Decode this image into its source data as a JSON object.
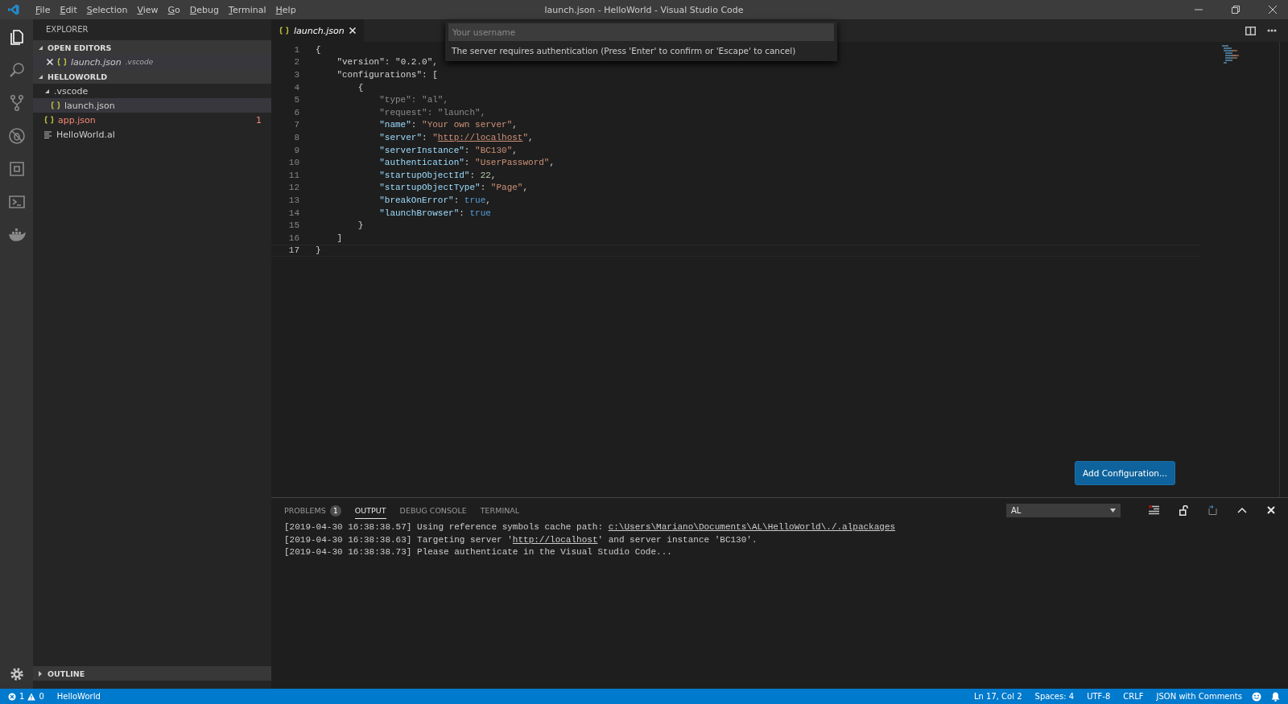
{
  "window": {
    "title": "launch.json - HelloWorld - Visual Studio Code"
  },
  "menu": [
    "File",
    "Edit",
    "Selection",
    "View",
    "Go",
    "Debug",
    "Terminal",
    "Help"
  ],
  "activity_bar": [
    {
      "kind": "files",
      "selected": true
    },
    {
      "kind": "search",
      "selected": false
    },
    {
      "kind": "scm",
      "selected": false
    },
    {
      "kind": "debug",
      "selected": false
    },
    {
      "kind": "extensions",
      "selected": false
    },
    {
      "kind": "terminal",
      "selected": false
    },
    {
      "kind": "docker",
      "selected": false
    }
  ],
  "sidebar": {
    "title": "EXPLORER",
    "open_editors": {
      "title": "OPEN EDITORS",
      "expanded": true,
      "items": [
        {
          "name": "launch.json",
          "folder": ".vscode",
          "kind": "json"
        }
      ]
    },
    "workspace": {
      "title": "HELLOWORLD",
      "expanded": true,
      "items": [
        {
          "name": ".vscode",
          "kind": "folder",
          "expanded": true,
          "selected": false,
          "children": [
            {
              "name": "launch.json",
              "kind": "json",
              "selected": true
            }
          ]
        },
        {
          "name": "app.json",
          "kind": "json",
          "selected": false,
          "errors": "1"
        },
        {
          "name": "HelloWorld.al",
          "kind": "file",
          "selected": false
        }
      ]
    },
    "outline": {
      "title": "OUTLINE",
      "expanded": false
    }
  },
  "editor": {
    "tabs": [
      {
        "label": "launch.json",
        "selected": true
      }
    ],
    "lines": [
      {
        "number": "1",
        "current": false,
        "tokens": [
          {
            "kind": "punct",
            "text": "{"
          }
        ]
      },
      {
        "number": "2",
        "current": false,
        "tokens": [
          {
            "kind": "plain",
            "text": "    \"version\""
          },
          {
            "kind": "punct",
            "text": ": "
          },
          {
            "kind": "plain",
            "text": "\"0.2.0\""
          },
          {
            "kind": "punct",
            "text": ","
          }
        ]
      },
      {
        "number": "3",
        "current": false,
        "tokens": [
          {
            "kind": "plain",
            "text": "    \"configurations\""
          },
          {
            "kind": "punct",
            "text": ": ["
          }
        ]
      },
      {
        "number": "4",
        "current": false,
        "tokens": [
          {
            "kind": "punct",
            "text": "        {"
          }
        ]
      },
      {
        "number": "5",
        "current": false,
        "tokens": [
          {
            "kind": "dim",
            "text": "            \"type\""
          },
          {
            "kind": "dim",
            "text": ": "
          },
          {
            "kind": "dim",
            "text": "\"al\""
          },
          {
            "kind": "dim",
            "text": ","
          }
        ]
      },
      {
        "number": "6",
        "current": false,
        "tokens": [
          {
            "kind": "dim",
            "text": "            \"request\""
          },
          {
            "kind": "dim",
            "text": ": "
          },
          {
            "kind": "dim",
            "text": "\"launch\""
          },
          {
            "kind": "dim",
            "text": ","
          }
        ]
      },
      {
        "number": "7",
        "current": false,
        "tokens": [
          {
            "kind": "key",
            "text": "            \"name\""
          },
          {
            "kind": "punct",
            "text": ": "
          },
          {
            "kind": "string",
            "text": "\"Your own server\""
          },
          {
            "kind": "punct",
            "text": ","
          }
        ]
      },
      {
        "number": "8",
        "current": false,
        "tokens": [
          {
            "kind": "key",
            "text": "            \"server\""
          },
          {
            "kind": "punct",
            "text": ": "
          },
          {
            "kind": "string",
            "text": "\""
          },
          {
            "kind": "link",
            "text": "http://localhost"
          },
          {
            "kind": "string",
            "text": "\""
          },
          {
            "kind": "punct",
            "text": ","
          }
        ]
      },
      {
        "number": "9",
        "current": false,
        "tokens": [
          {
            "kind": "key",
            "text": "            \"serverInstance\""
          },
          {
            "kind": "punct",
            "text": ": "
          },
          {
            "kind": "string",
            "text": "\"BC130\""
          },
          {
            "kind": "punct",
            "text": ","
          }
        ]
      },
      {
        "number": "10",
        "current": false,
        "tokens": [
          {
            "kind": "key",
            "text": "            \"authentication\""
          },
          {
            "kind": "punct",
            "text": ": "
          },
          {
            "kind": "string",
            "text": "\"UserPassword\""
          },
          {
            "kind": "punct",
            "text": ","
          }
        ]
      },
      {
        "number": "11",
        "current": false,
        "tokens": [
          {
            "kind": "key",
            "text": "            \"startupObjectId\""
          },
          {
            "kind": "punct",
            "text": ": "
          },
          {
            "kind": "number",
            "text": "22"
          },
          {
            "kind": "punct",
            "text": ","
          }
        ]
      },
      {
        "number": "12",
        "current": false,
        "tokens": [
          {
            "kind": "key",
            "text": "            \"startupObjectType\""
          },
          {
            "kind": "punct",
            "text": ": "
          },
          {
            "kind": "string",
            "text": "\"Page\""
          },
          {
            "kind": "punct",
            "text": ","
          }
        ]
      },
      {
        "number": "13",
        "current": false,
        "tokens": [
          {
            "kind": "key",
            "text": "            \"breakOnError\""
          },
          {
            "kind": "punct",
            "text": ": "
          },
          {
            "kind": "keyword",
            "text": "true"
          },
          {
            "kind": "punct",
            "text": ","
          }
        ]
      },
      {
        "number": "14",
        "current": false,
        "tokens": [
          {
            "kind": "key",
            "text": "            \"launchBrowser\""
          },
          {
            "kind": "punct",
            "text": ": "
          },
          {
            "kind": "keyword",
            "text": "true"
          }
        ]
      },
      {
        "number": "15",
        "current": false,
        "tokens": [
          {
            "kind": "punct",
            "text": "        }"
          }
        ]
      },
      {
        "number": "16",
        "current": false,
        "tokens": [
          {
            "kind": "punct",
            "text": "    ]"
          }
        ]
      },
      {
        "number": "17",
        "current": true,
        "tokens": [
          {
            "kind": "punct",
            "text": "}"
          }
        ]
      }
    ],
    "add_button": "Add Configuration..."
  },
  "quick_input": {
    "placeholder": "Your username",
    "message": "The server requires authentication (Press 'Enter' to confirm or 'Escape' to cancel)"
  },
  "panel": {
    "tabs": [
      {
        "label": "PROBLEMS",
        "badge": "1",
        "selected": false
      },
      {
        "label": "OUTPUT",
        "selected": true
      },
      {
        "label": "DEBUG CONSOLE",
        "selected": false
      },
      {
        "label": "TERMINAL",
        "selected": false
      }
    ],
    "channel": "AL",
    "lines": [
      [
        {
          "kind": "text",
          "text": "[2019-04-30 16:38:38.57] Using reference symbols cache path: "
        },
        {
          "kind": "link",
          "text": "c:\\Users\\Mariano\\Documents\\AL\\HelloWorld\\./.alpackages"
        }
      ],
      [
        {
          "kind": "text",
          "text": "[2019-04-30 16:38:38.63] Targeting server '"
        },
        {
          "kind": "link",
          "text": "http://localhost"
        },
        {
          "kind": "text",
          "text": "' and server instance 'BC130'."
        }
      ],
      [
        {
          "kind": "text",
          "text": "[2019-04-30 16:38:38.73] Please authenticate in the Visual Studio Code..."
        }
      ]
    ]
  },
  "status_bar": {
    "errors": "1",
    "warnings": "0",
    "project": "HelloWorld",
    "right": [
      "Ln 17, Col 2",
      "Spaces: 4",
      "UTF-8",
      "CRLF",
      "JSON with Comments"
    ]
  }
}
